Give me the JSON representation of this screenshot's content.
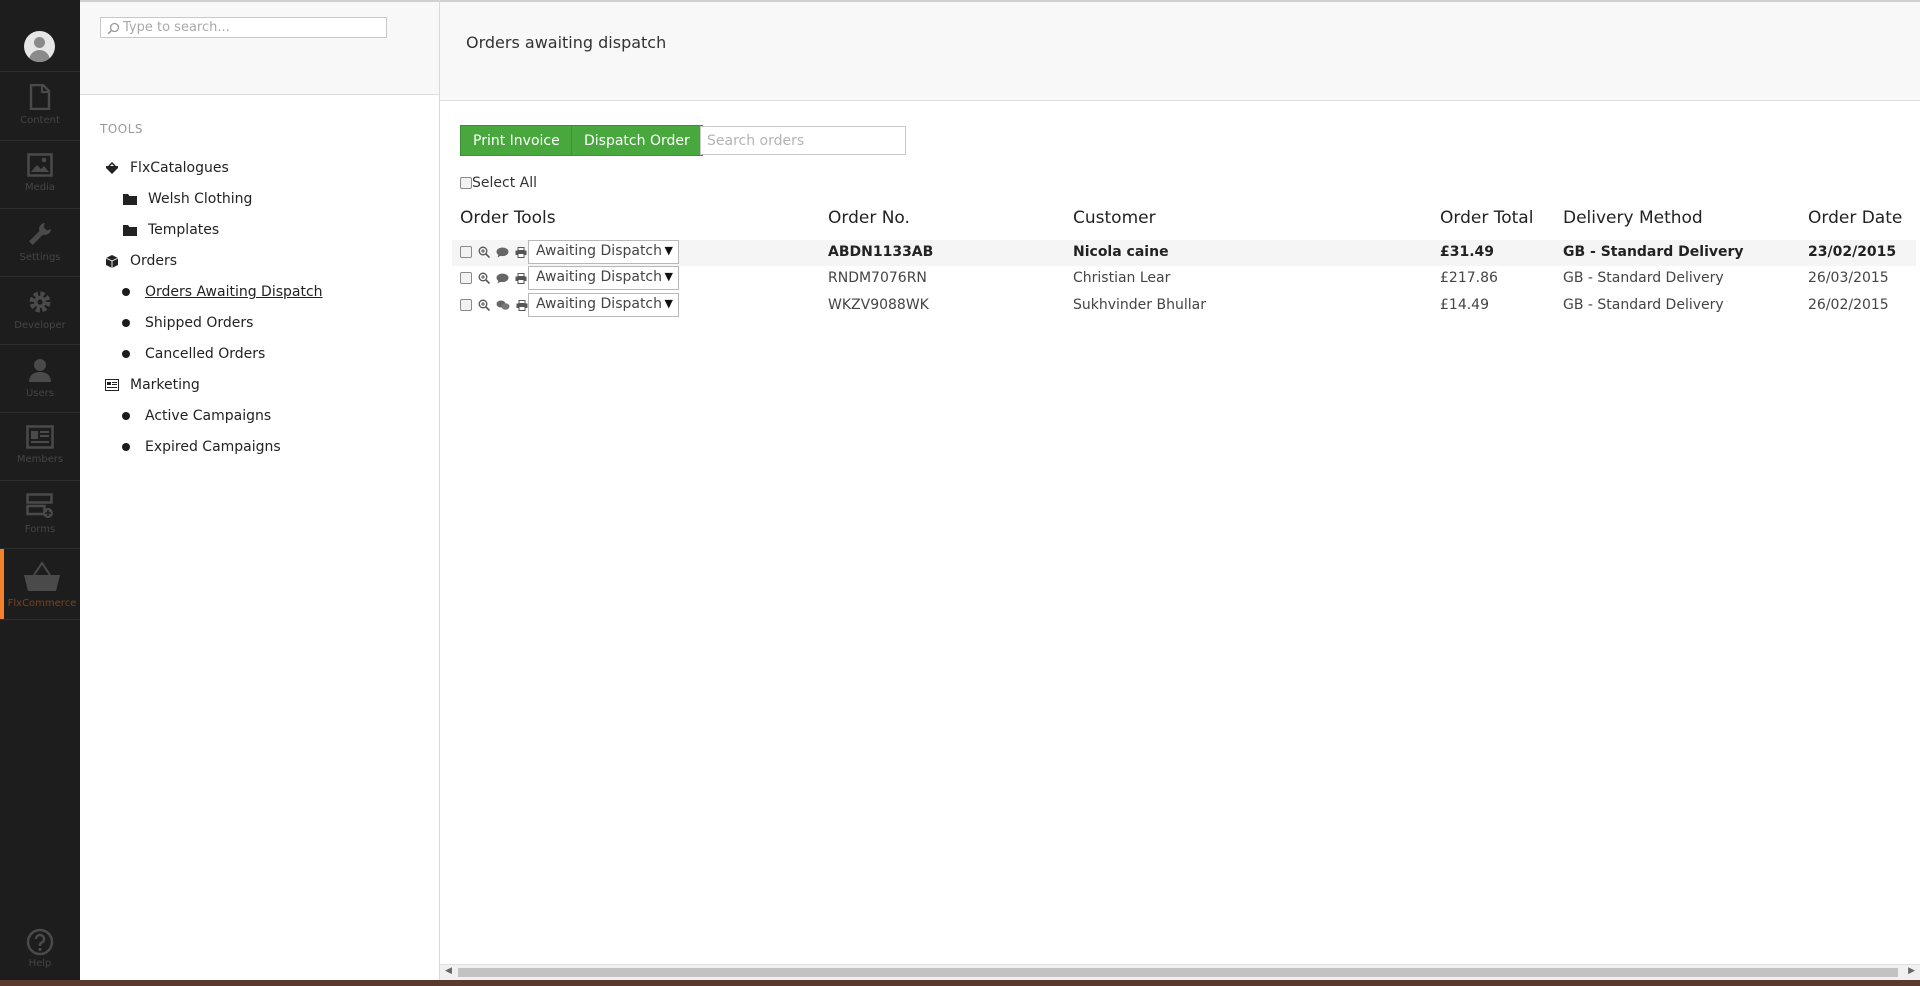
{
  "rail": {
    "items": [
      {
        "label": "Content",
        "icon": "document-icon"
      },
      {
        "label": "Media",
        "icon": "image-icon"
      },
      {
        "label": "Settings",
        "icon": "wrench-icon"
      },
      {
        "label": "Developer",
        "icon": "gear-icon"
      },
      {
        "label": "Users",
        "icon": "user-icon"
      },
      {
        "label": "Members",
        "icon": "id-card-icon"
      },
      {
        "label": "Forms",
        "icon": "form-icon"
      },
      {
        "label": "FlxCommerce",
        "icon": "basket-icon"
      }
    ],
    "help_label": "Help",
    "accent_color": "#f5822a"
  },
  "tree": {
    "search_placeholder": "Type to search...",
    "heading": "TOOLS",
    "nodes": [
      {
        "label": "FlxCatalogues",
        "icon": "catalogue-icon"
      },
      {
        "label": "Welsh Clothing",
        "icon": "folder-icon"
      },
      {
        "label": "Templates",
        "icon": "folder-icon"
      },
      {
        "label": "Orders",
        "icon": "box-icon"
      },
      {
        "label": "Orders Awaiting Dispatch",
        "icon": "bullet-icon"
      },
      {
        "label": "Shipped Orders",
        "icon": "bullet-icon"
      },
      {
        "label": "Cancelled Orders",
        "icon": "bullet-icon"
      },
      {
        "label": "Marketing",
        "icon": "campaign-icon"
      },
      {
        "label": "Active Campaigns",
        "icon": "bullet-icon"
      },
      {
        "label": "Expired Campaigns",
        "icon": "bullet-icon"
      }
    ]
  },
  "main": {
    "title": "Orders awaiting dispatch",
    "print_invoice_label": "Print Invoice",
    "dispatch_order_label": "Dispatch Order",
    "search_placeholder": "Search orders",
    "select_all_label": "Select All",
    "button_color": "#48a83d",
    "columns": [
      "Order Tools",
      "Order No.",
      "Customer",
      "Order Total",
      "Delivery Method",
      "Order Date"
    ],
    "orders": [
      {
        "status": "Awaiting Dispatch",
        "order_no": "ABDN1133AB",
        "customer": "Nicola caine",
        "total": "£31.49",
        "delivery": "GB - Standard Delivery",
        "date": "23/02/2015"
      },
      {
        "status": "Awaiting Dispatch",
        "order_no": "RNDM7076RN",
        "customer": "Christian Lear",
        "total": "£217.86",
        "delivery": "GB - Standard Delivery",
        "date": "26/03/2015"
      },
      {
        "status": "Awaiting Dispatch",
        "order_no": "WKZV9088WK",
        "customer": "Sukhvinder Bhullar",
        "total": "£14.49",
        "delivery": "GB - Standard Delivery",
        "date": "26/02/2015"
      }
    ]
  }
}
